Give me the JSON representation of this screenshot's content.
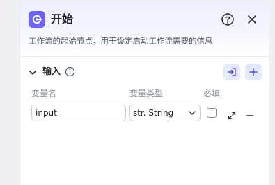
{
  "node": {
    "title": "开始",
    "description": "工作流的起始节点，用于设定启动工作流需要的信息",
    "accent_color": "#6b63f6"
  },
  "input_section": {
    "title": "输入",
    "columns": {
      "name": "变量名",
      "type": "变量类型",
      "required": "必填"
    },
    "rows": [
      {
        "name": "input",
        "type": "str. String",
        "required": false
      }
    ]
  },
  "icons": [
    "start-node-icon",
    "help-icon",
    "close-icon",
    "chevron-down-icon",
    "info-icon",
    "import-icon",
    "add-icon",
    "expand-icon",
    "minus-icon"
  ]
}
